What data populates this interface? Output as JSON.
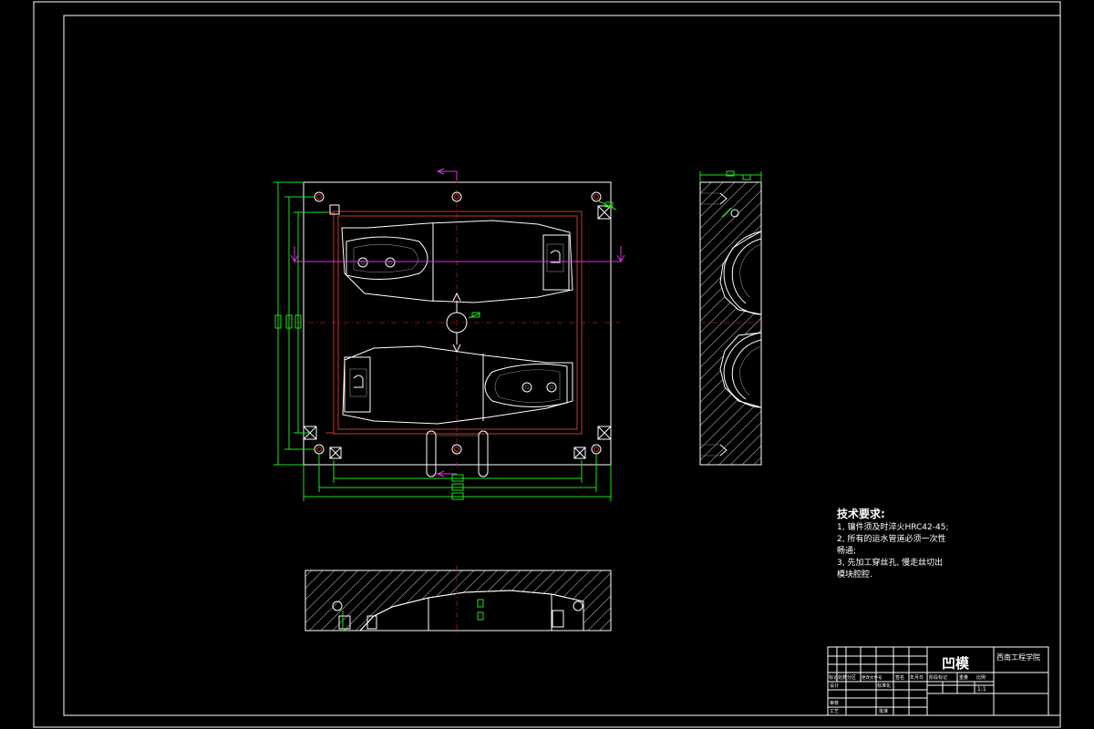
{
  "tech_requirements": {
    "title": "技术要求:",
    "items": [
      "1, 镶件须及时淬火HRC42-45;",
      "2, 所有的运水管道必须一次性",
      "   畅通;",
      "3, 先加工穿丝孔, 慢走丝切出",
      "   模块腔腔."
    ]
  },
  "title_block": {
    "drawing_name": "凹模",
    "institution": "西南工程学院",
    "row_labels": [
      "标记",
      "处数",
      "分区",
      "更改文件号",
      "签名",
      "年月日"
    ],
    "designer_label": "设计",
    "standard_label": "标准化",
    "review_label": "审核",
    "process_label": "工艺",
    "approve_label": "批准",
    "stage_label": "阶段标记",
    "weight_label": "重量",
    "scale_label": "比例",
    "scale_value": "1:1"
  },
  "colors": {
    "outline": "#ffffff",
    "cooling_channel": "#c8372d",
    "dimension": "#19e619",
    "section_marker": "#e62ee6",
    "background": "#000000"
  }
}
